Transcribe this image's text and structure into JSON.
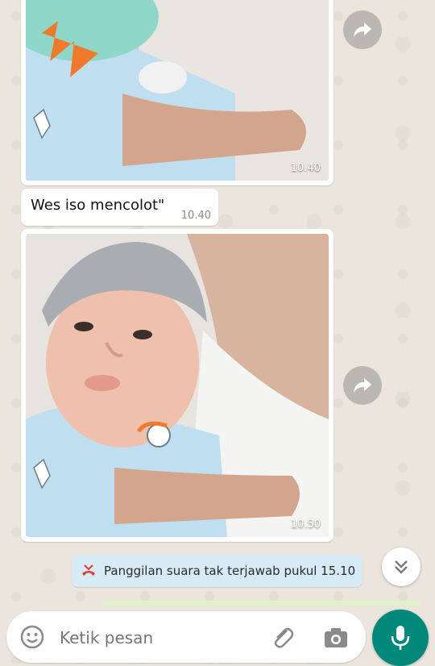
{
  "chat": {
    "messages": [
      {
        "type": "image",
        "time": "10.40"
      },
      {
        "type": "text",
        "text": "Wes iso mencolot\"",
        "time": "10.40"
      },
      {
        "type": "image",
        "time": "10.50"
      }
    ],
    "system_notice": {
      "text": "Panggilan suara tak terjawab pukul 15.10",
      "icon": "missed-call-icon"
    }
  },
  "composer": {
    "placeholder": "Ketik pesan",
    "icons": [
      "emoji-icon",
      "attach-icon",
      "camera-icon",
      "mic-icon"
    ]
  },
  "colors": {
    "wallpaper": "#ece5dd",
    "bubble": "#ffffff",
    "notice": "#d7ebf6",
    "accent": "#00897b",
    "missed_call": "#e53935"
  }
}
